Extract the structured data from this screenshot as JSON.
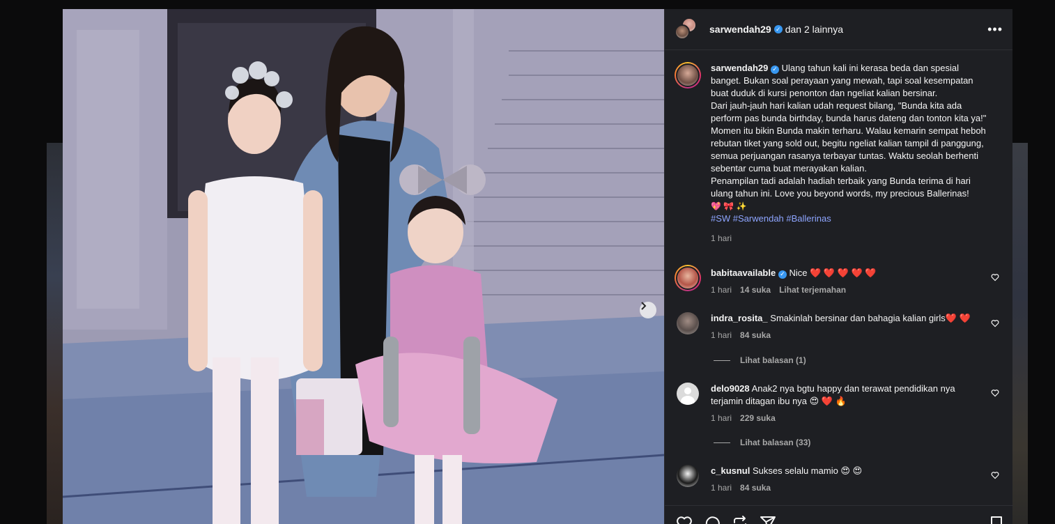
{
  "post": {
    "header": {
      "username": "sarwendah29",
      "collab_text": "dan 2 lainnya",
      "more_icon": "more-horizontal-icon"
    },
    "caption": {
      "username": "sarwendah29",
      "text": "Ulang tahun kali ini kerasa beda dan spesial banget. Bukan soal perayaan yang mewah, tapi soal kesempatan buat duduk di kursi penonton dan ngeliat kalian bersinar.",
      "text2": "Dari jauh-jauh hari kalian udah request bilang, \"Bunda kita ada perform pas bunda birthday, bunda harus dateng dan tonton kita ya!\" Momen itu bikin Bunda makin terharu. Walau kemarin sempat heboh rebutan tiket yang sold out, begitu ngeliat kalian tampil di panggung, semua perjuangan rasanya terbayar tuntas. Waktu seolah berhenti sebentar cuma buat merayakan kalian.",
      "text3": "Penampilan tadi adalah hadiah terbaik yang Bunda terima di hari ulang tahun ini. Love you beyond words, my precious Ballerinas!",
      "emojis": "💖 🎀 ✨",
      "hashtags": "#SW #Sarwendah #Ballerinas",
      "time": "1 hari"
    },
    "comments": [
      {
        "username": "babitaavailable",
        "verified": true,
        "text": "Nice ❤️ ❤️ ❤️ ❤️ ❤️",
        "time": "1 hari",
        "likes": "14 suka",
        "extra": "Lihat terjemahan"
      },
      {
        "username": "indra_rosita_",
        "verified": false,
        "text": "Smakinlah bersinar dan bahagia kalian girls❤️ ❤️",
        "time": "1 hari",
        "likes": "84 suka",
        "replies": "Lihat balasan (1)"
      },
      {
        "username": "delo9028",
        "verified": false,
        "text": "Anak2 nya bgtu happy dan terawat pendidikan nya terjamin ditagan ibu nya 😍 ❤️ 🔥",
        "time": "1 hari",
        "likes": "229 suka",
        "replies": "Lihat balasan (33)"
      },
      {
        "username": "c_kusnul",
        "verified": false,
        "text": "Sukses selalu mamio 😍 😍",
        "time": "1 hari",
        "likes": "84 suka"
      }
    ],
    "actions": {
      "like_icon": "heart-icon",
      "comment_icon": "comment-icon",
      "repost_icon": "repost-icon",
      "share_icon": "send-icon",
      "save_icon": "bookmark-icon"
    },
    "carousel": {
      "next_icon": "chevron-right-icon"
    }
  }
}
